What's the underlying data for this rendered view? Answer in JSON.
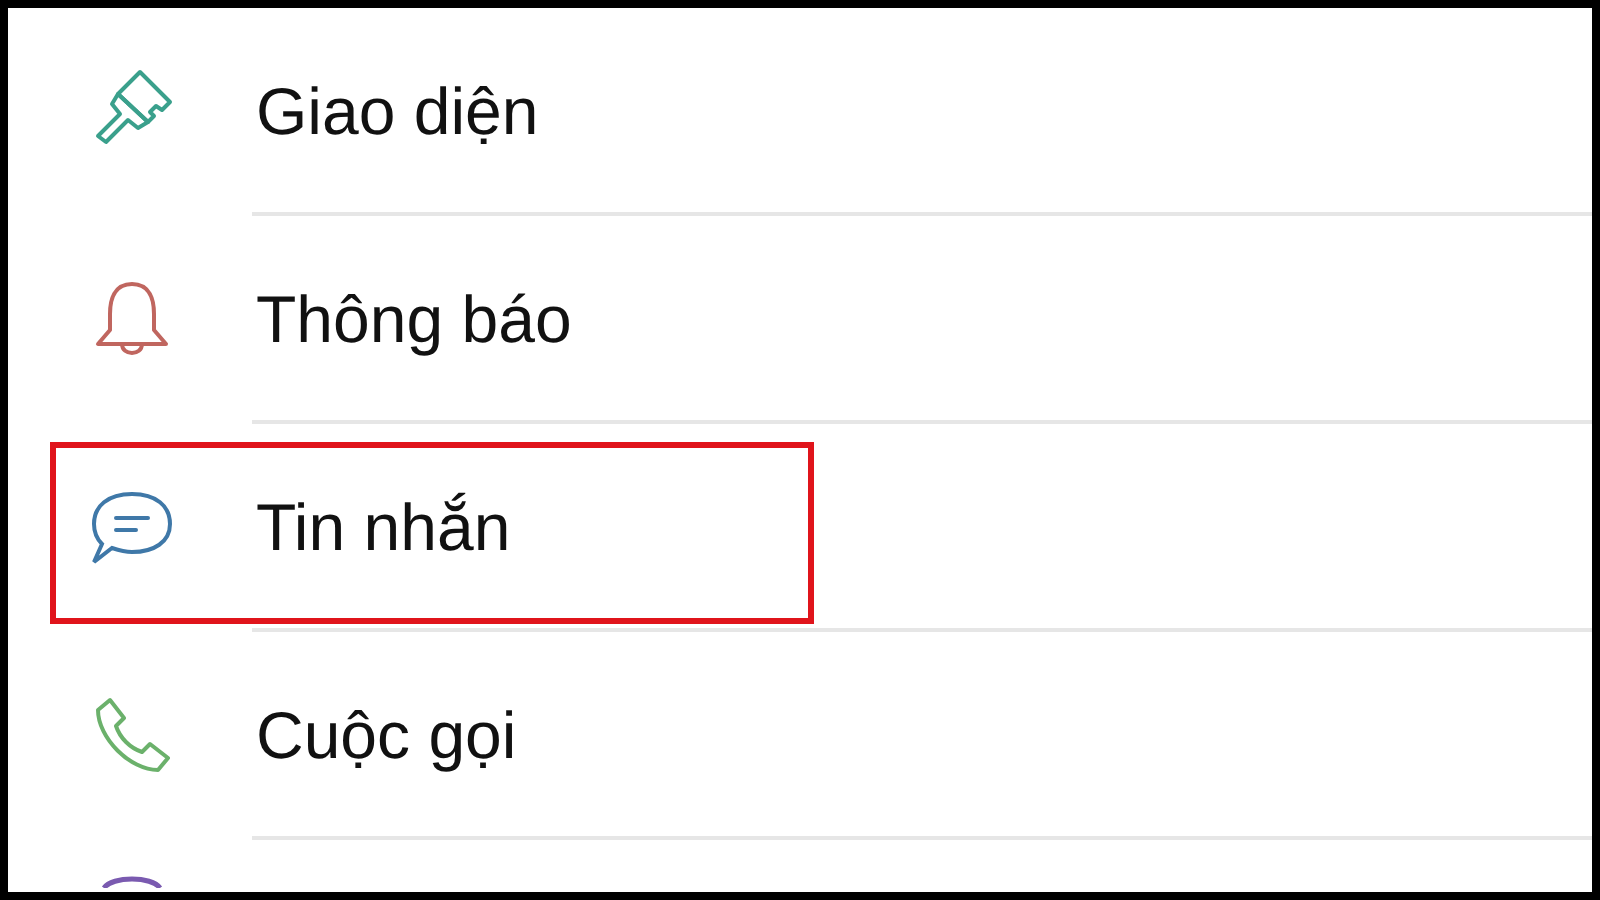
{
  "settings_items": [
    {
      "kind": "appearance",
      "label": "Giao diện",
      "highlighted": false
    },
    {
      "kind": "notification",
      "label": "Thông báo",
      "highlighted": false
    },
    {
      "kind": "message",
      "label": "Tin nhắn",
      "highlighted": true
    },
    {
      "kind": "call",
      "label": "Cuộc gọi",
      "highlighted": false
    },
    {
      "kind": "partial"
    }
  ]
}
